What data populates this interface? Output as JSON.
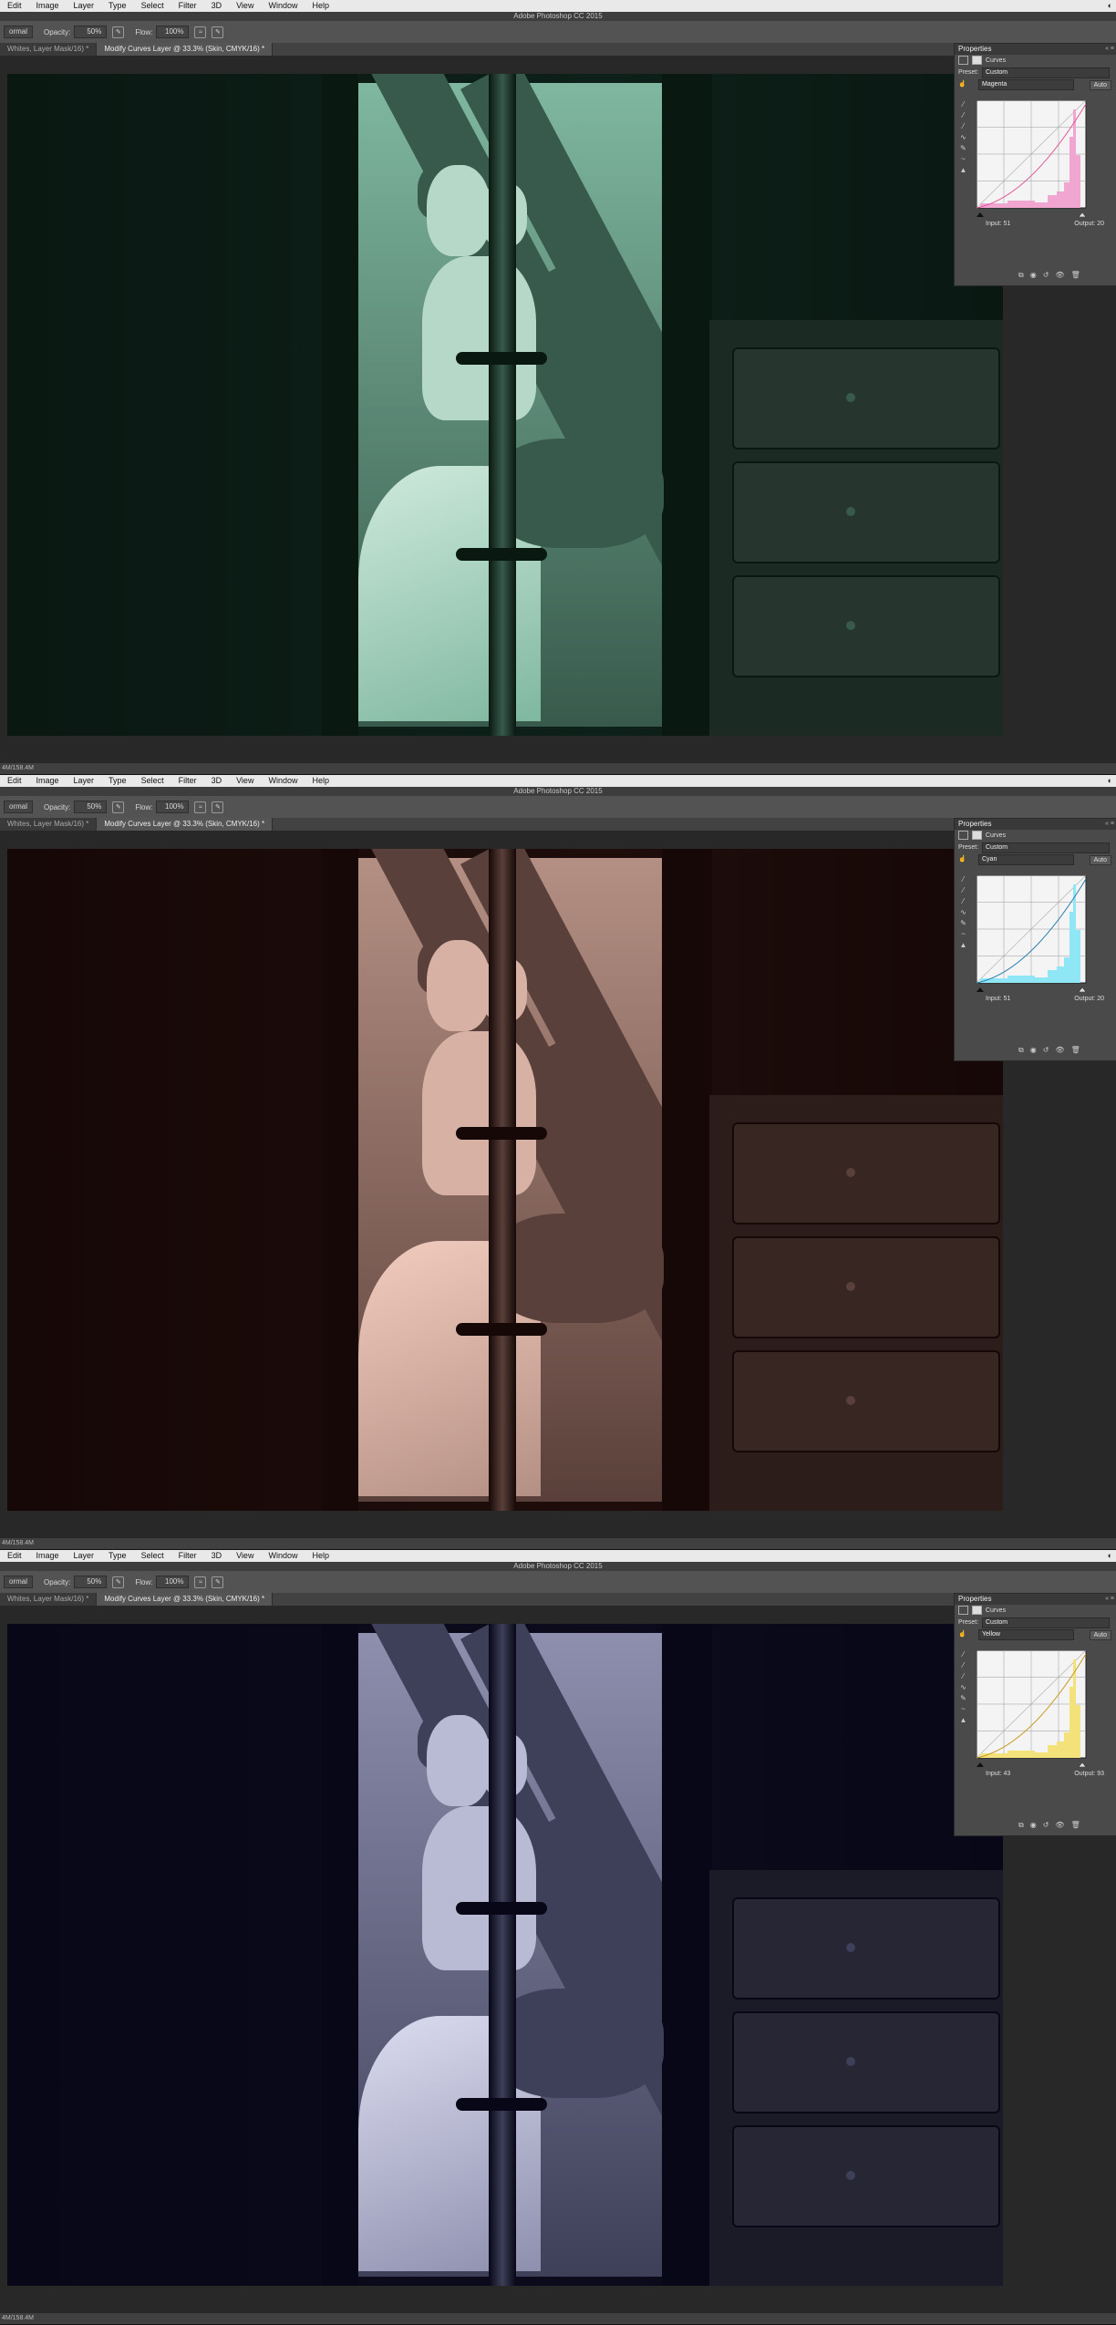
{
  "menu": {
    "items": [
      "Edit",
      "Image",
      "Layer",
      "Type",
      "Select",
      "Filter",
      "3D",
      "View",
      "Window",
      "Help"
    ]
  },
  "app_title": "Adobe Photoshop CC 2015",
  "options": {
    "mode": "ormal",
    "opacity_label": "Opacity:",
    "opacity_value": "50%",
    "flow_label": "Flow:",
    "flow_value": "100%"
  },
  "tabs": {
    "tab1": "Whites, Layer Mask/16) *",
    "tab2": "Modify Curves Layer @ 33.3% (Skin, CMYK/16) *"
  },
  "status": "4M/158.4M",
  "properties": {
    "title": "Properties",
    "panel_name": "Curves",
    "preset_label": "Preset:",
    "preset_value": "Custom",
    "auto_label": "Auto",
    "input_label": "Input:",
    "output_label": "Output:"
  },
  "screens": [
    {
      "channel": "Magenta",
      "input": "51",
      "output": "20",
      "curve_color": "#e05a9a",
      "hist_color": "#f0a6d0",
      "tint": {
        "wall": "#0d2019",
        "window": "#7fb7a0",
        "stripe": "#385a4c",
        "skin": "#b6d8c8",
        "dress": "#cfeadd",
        "dark": "#0a1812",
        "dresser": "#1c2a24",
        "drawer": "#26362f"
      }
    },
    {
      "channel": "Cyan",
      "input": "51",
      "output": "20",
      "curve_color": "#2a7db0",
      "hist_color": "#8fe6f5",
      "tint": {
        "wall": "#1e0d0b",
        "window": "#b48f83",
        "stripe": "#5a403a",
        "skin": "#d7b2a4",
        "dress": "#f2cdbf",
        "dark": "#160807",
        "dresser": "#2c1d1a",
        "drawer": "#382623"
      }
    },
    {
      "channel": "Yellow",
      "input": "43",
      "output": "93",
      "curve_color": "#c79a1e",
      "hist_color": "#f3e27a",
      "tint": {
        "wall": "#0b0b1c",
        "window": "#8e8fae",
        "stripe": "#3e3f58",
        "skin": "#b9bad3",
        "dress": "#dcdcf0",
        "dark": "#070717",
        "dresser": "#1b1b27",
        "drawer": "#262634"
      }
    }
  ]
}
